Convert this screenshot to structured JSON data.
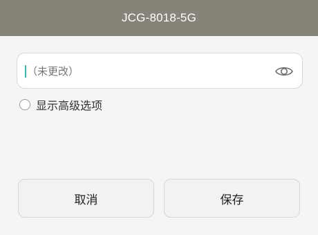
{
  "header": {
    "title": "JCG-8018-5G"
  },
  "password_field": {
    "placeholder": "（未更改）",
    "value": "",
    "visibility_icon": "eye-icon"
  },
  "advanced": {
    "label": "显示高级选项",
    "checked": false
  },
  "buttons": {
    "cancel_label": "取消",
    "save_label": "保存"
  },
  "colors": {
    "header_bg": "#868479",
    "caret": "#3bb6b0",
    "page_bg": "#f5f5f5"
  }
}
